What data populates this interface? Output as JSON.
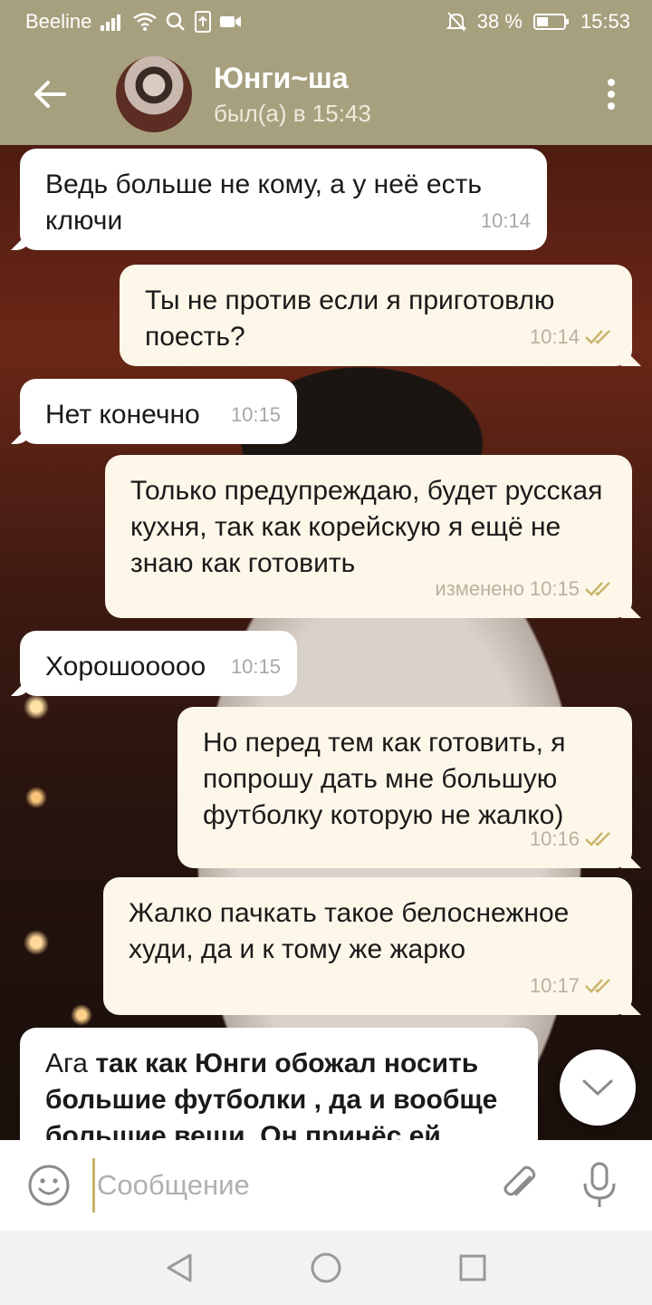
{
  "status_bar": {
    "carrier": "Beeline",
    "battery_percent": "38 %",
    "time": "15:53",
    "icons": [
      "signal-icon",
      "wifi-icon",
      "search-icon",
      "upload-icon",
      "video-icon",
      "mute-icon",
      "battery-icon"
    ]
  },
  "header": {
    "name": "Юнги~ша",
    "status": "был(а) в 15:43"
  },
  "messages": [
    {
      "direction": "in",
      "text": "Ведь больше не кому, а у неё есть ключи",
      "time": "10:14"
    },
    {
      "direction": "out",
      "text": "Ты не против если я приготовлю поесть?",
      "time": "10:14",
      "read": true
    },
    {
      "direction": "in",
      "text": "Нет конечно",
      "time": "10:15"
    },
    {
      "direction": "out",
      "text": "Только предупреждаю, будет русская кухня, так как корейскую я ещё не знаю как готовить",
      "time": "10:15",
      "edited_label": "изменено",
      "read": true
    },
    {
      "direction": "in",
      "text": "Хорошооооо",
      "time": "10:15"
    },
    {
      "direction": "out",
      "text": "Но перед тем как готовить, я попрошу дать мне большую футболку которую не жалко)",
      "time": "10:16",
      "read": true
    },
    {
      "direction": "out",
      "text": "Жалко пачкать такое белоснежное худи, да и к тому же жарко",
      "time": "10:17",
      "read": true
    },
    {
      "direction": "in",
      "text_plain": "Ага",
      "text_bold": "так как Юнги обожал носить большие футболки , да и вообще большие вещи. Он принёс ей"
    }
  ],
  "input": {
    "placeholder": "Сообщение"
  },
  "colors": {
    "header_bg": "#a7a07e",
    "incoming_bubble": "#ffffff",
    "outgoing_bubble": "#fcf7e8",
    "read_check": "#c8b46a"
  }
}
